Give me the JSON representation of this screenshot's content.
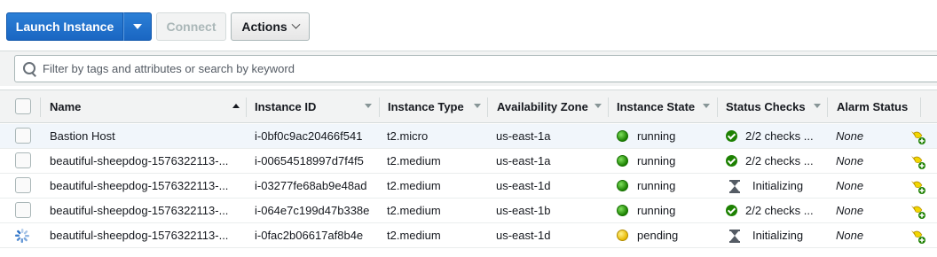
{
  "toolbar": {
    "launch_label": "Launch Instance",
    "connect_label": "Connect",
    "actions_label": "Actions"
  },
  "filter": {
    "placeholder": "Filter by tags and attributes or search by keyword"
  },
  "columns": [
    "Name",
    "Instance ID",
    "Instance Type",
    "Availability Zone",
    "Instance State",
    "Status Checks",
    "Alarm Status"
  ],
  "rows": [
    {
      "name": "Bastion Host",
      "id": "i-0bf0c9ac20466f541",
      "type": "t2.micro",
      "zone": "us-east-1a",
      "state": "running",
      "checks": "2/2 checks ...",
      "alarm": "None"
    },
    {
      "name": "beautiful-sheepdog-1576322113-...",
      "id": "i-00654518997d7f4f5",
      "type": "t2.medium",
      "zone": "us-east-1a",
      "state": "running",
      "checks": "2/2 checks ...",
      "alarm": "None"
    },
    {
      "name": "beautiful-sheepdog-1576322113-...",
      "id": "i-03277fe68ab9e48ad",
      "type": "t2.medium",
      "zone": "us-east-1d",
      "state": "running",
      "checks": "Initializing",
      "alarm": "None"
    },
    {
      "name": "beautiful-sheepdog-1576322113-...",
      "id": "i-064e7c199d47b338e",
      "type": "t2.medium",
      "zone": "us-east-1b",
      "state": "running",
      "checks": "2/2 checks ...",
      "alarm": "None"
    },
    {
      "name": "beautiful-sheepdog-1576322113-...",
      "id": "i-0fac2b06617af8b4e",
      "type": "t2.medium",
      "zone": "us-east-1d",
      "state": "pending",
      "checks": "Initializing",
      "alarm": "None"
    }
  ],
  "colors": {
    "primary": "#1a66c2",
    "running": "#1d8102",
    "pending": "#e8b800"
  },
  "icons": {
    "search": "search-icon",
    "running": "green-dot-icon",
    "pending": "yellow-dot-icon",
    "checks_ok": "check-circle-icon",
    "initializing": "hourglass-icon",
    "alarm": "add-alarm-icon",
    "loading": "spinner-icon"
  }
}
